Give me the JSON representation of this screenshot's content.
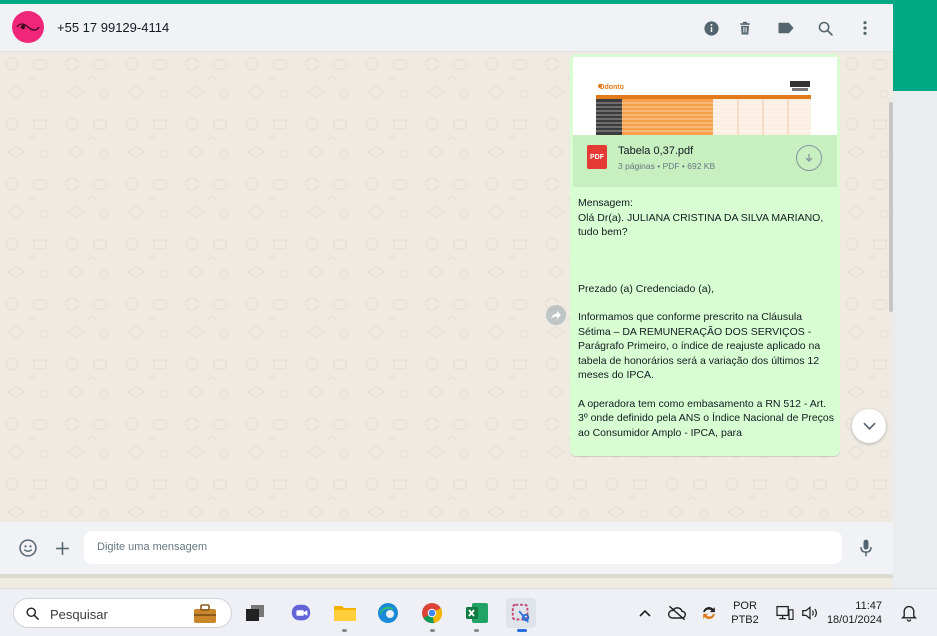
{
  "header": {
    "contact_name": "+55 17 99129-4114",
    "icons": [
      "info-icon",
      "trash-icon",
      "label-icon",
      "search-icon",
      "menu-icon"
    ]
  },
  "attachment": {
    "file_name": "Tabela 0,37.pdf",
    "file_meta": "3 páginas • PDF • 692 KB",
    "badge": "PDF"
  },
  "message": {
    "paragraphs": [
      "Mensagem:\nOlá Dr(a). JULIANA CRISTINA DA SILVA MARIANO, tudo bem?",
      "Prezado (a) Credenciado (a),",
      "Informamos que conforme prescrito na Cláusula Sétima – DA REMUNERAÇÃO DOS SERVIÇOS - Parágrafo Primeiro, o índice de reajuste aplicado na tabela de honorários será a variação dos últimos 12 meses do IPCA.",
      "A operadora tem como embasamento a RN 512 - Art. 3º onde definido pela ANS o Índice Nacional de Preços ao Consumidor Amplo - IPCA, para"
    ]
  },
  "composer": {
    "placeholder": "Digite uma mensagem"
  },
  "taskbar": {
    "search_label": "Pesquisar",
    "language_top": "POR",
    "language_bottom": "PTB2",
    "time": "11:47",
    "date": "18/01/2024"
  },
  "colors": {
    "accent": "#00a884",
    "bubble": "#d9fdd3",
    "avatar": "#f0267a",
    "pdf": "#e53935"
  }
}
